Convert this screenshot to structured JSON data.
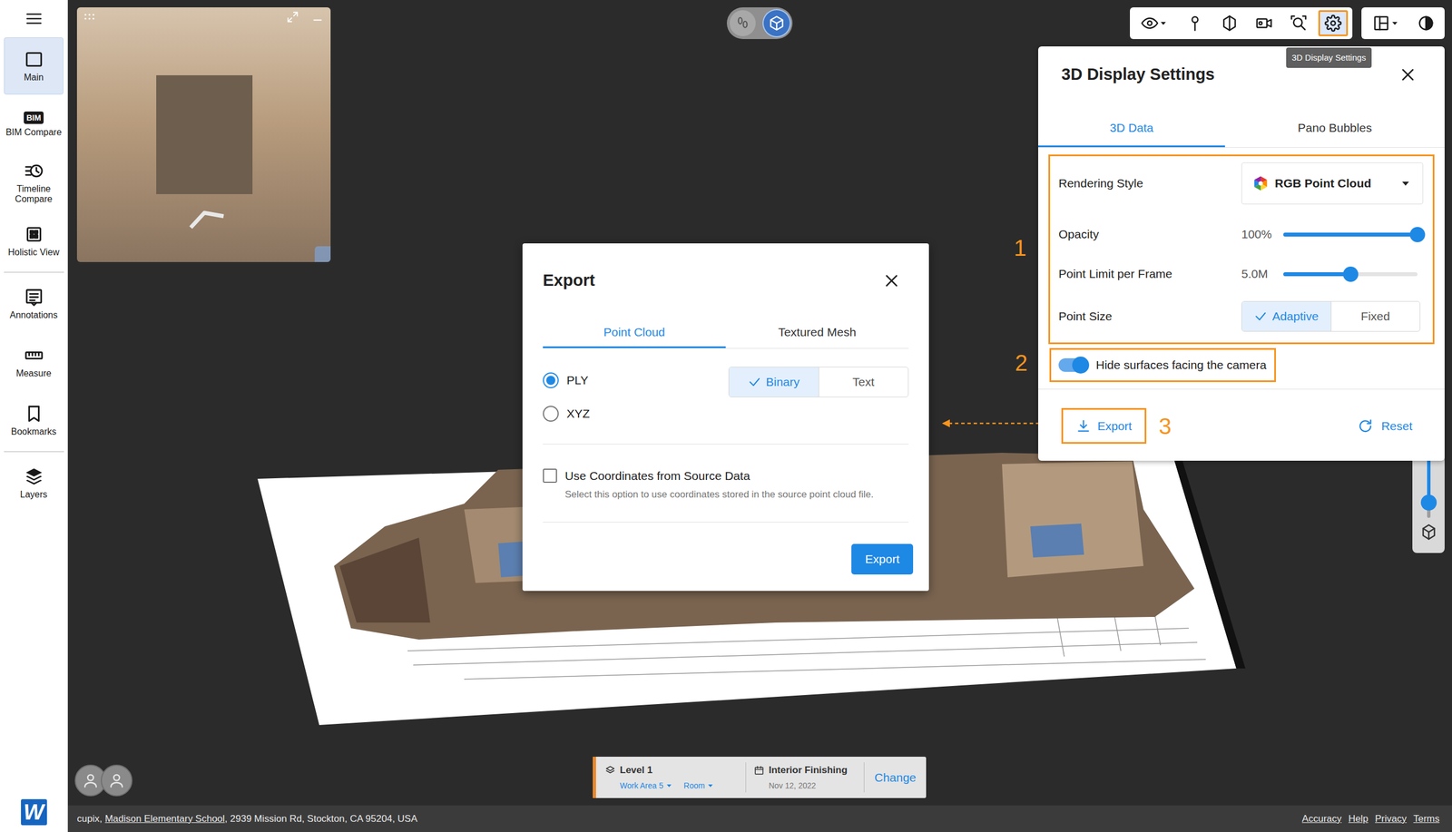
{
  "sidebar": {
    "groups": [
      [
        {
          "label": "Main",
          "selected": true
        },
        {
          "label": "BIM Compare",
          "selected": false,
          "icon_text": "BIM"
        },
        {
          "label": "Timeline Compare",
          "selected": false
        },
        {
          "label": "Holistic View",
          "selected": false
        }
      ],
      [
        {
          "label": "Annotations",
          "selected": false
        },
        {
          "label": "Measure",
          "selected": false
        },
        {
          "label": "Bookmarks",
          "selected": false
        }
      ],
      [
        {
          "label": "Layers",
          "selected": false
        }
      ]
    ],
    "logo": "W"
  },
  "viewer_modes": [
    {
      "selected": false
    },
    {
      "selected": true
    }
  ],
  "toolbar": {
    "buttons": [
      {
        "selected": false
      },
      {
        "selected": false
      },
      {
        "selected": false
      },
      {
        "selected": false
      },
      {
        "selected": false
      },
      {
        "selected": true
      }
    ],
    "extra_buttons": [
      {
        "selected": false
      },
      {
        "selected": false
      }
    ],
    "tooltip": "3D Display Settings"
  },
  "settings_panel": {
    "title": "3D Display Settings",
    "tabs": [
      {
        "label": "3D Data",
        "selected": true
      },
      {
        "label": "Pano Bubbles",
        "selected": false
      }
    ],
    "rows": [
      {
        "kind": "dropdown",
        "label": "Rendering Style",
        "value": "RGB Point Cloud"
      },
      {
        "kind": "slider",
        "label": "Opacity",
        "reading": "100%",
        "level": 1
      },
      {
        "kind": "slider",
        "label": "Point Limit per Frame",
        "reading": "5.0M",
        "level": 0.5
      },
      {
        "kind": "segmented",
        "label": "Point Size",
        "options": [
          {
            "label": "Adaptive",
            "selected": true
          },
          {
            "label": "Fixed",
            "selected": false
          }
        ]
      }
    ],
    "toggle": {
      "label": "Hide surfaces facing the camera",
      "on": true
    },
    "export_button": "Export",
    "reset_button": "Reset"
  },
  "export_dialog": {
    "title": "Export",
    "tabs": [
      {
        "label": "Point Cloud",
        "selected": true
      },
      {
        "label": "Textured Mesh",
        "selected": false
      }
    ],
    "formats": [
      {
        "label": "PLY",
        "selected": true
      },
      {
        "label": "XYZ",
        "selected": false
      }
    ],
    "encodings": [
      {
        "label": "Binary",
        "selected": true
      },
      {
        "label": "Text",
        "selected": false
      }
    ],
    "coordinates": {
      "label": "Use Coordinates from Source Data",
      "checked": false,
      "description": "Select this option to use coordinates stored in the source point cloud file."
    },
    "button": "Export"
  },
  "callouts": [
    "1",
    "2",
    "3"
  ],
  "side_slider": {
    "level": 0.78
  },
  "location_bar": {
    "level": "Level 1",
    "work_area": "Work Area 5",
    "room": "Room",
    "phase": "Interior Finishing",
    "date": "Nov 12, 2022",
    "change": "Change"
  },
  "status_bar": {
    "company": "cupix,",
    "project": "Madison Elementary School",
    "address": ", 2939 Mission Rd, Stockton, CA 95204, USA",
    "links": [
      "Accuracy",
      "Help",
      "Privacy",
      "Terms"
    ]
  }
}
